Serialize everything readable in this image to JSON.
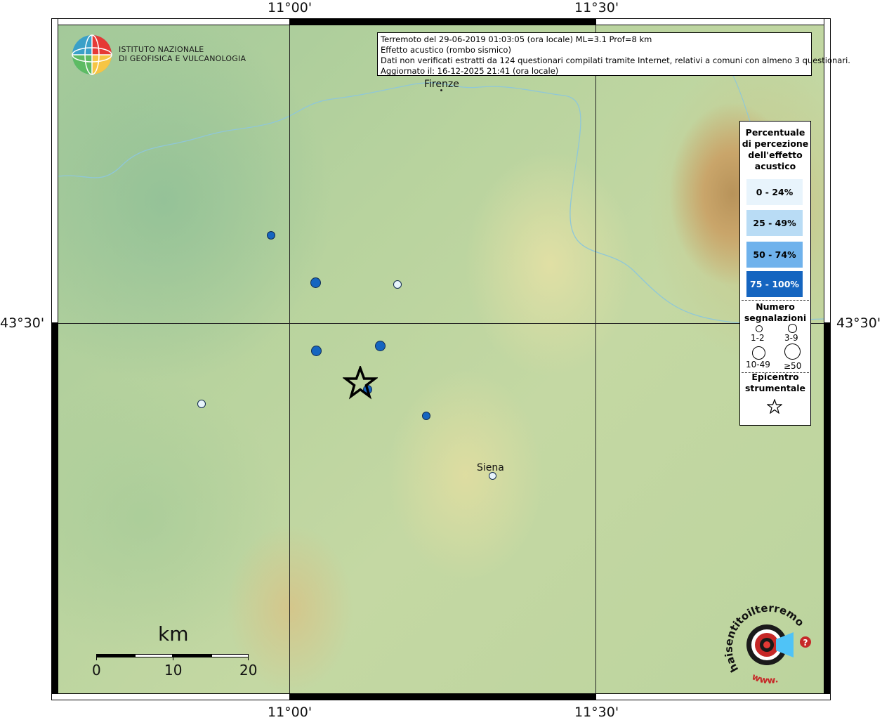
{
  "axes": {
    "lon_labels": [
      "11°00'",
      "11°30'"
    ],
    "lat_labels": [
      "43°30'"
    ]
  },
  "header": {
    "line1": "Terremoto del 29-06-2019 01:03:05 (ora locale) ML=3.1 Prof=8 km",
    "line2": "Effetto acustico (rombo sismico)",
    "line3": "Dati non verificati estratti da 124 questionari compilati tramite Internet, relativi a comuni con almeno 3 questionari.",
    "line4": "Aggiornato il: 16-12-2025 21:41 (ora locale)"
  },
  "logo": {
    "institute_line1": "ISTITUTO NAZIONALE",
    "institute_line2": "DI GEOFISICA E VULCANOLOGIA",
    "hsit_text": "haisentitoilterremoto.it",
    "hsit_www": "www."
  },
  "places": {
    "firenze": "Firenze",
    "siena": "Siena"
  },
  "legend": {
    "title_line1": "Percentuale",
    "title_line2": "di percezione",
    "title_line3": "dell'effetto",
    "title_line4": "acustico",
    "classes": [
      {
        "label": "0 - 24%",
        "color": "#e8f4fc"
      },
      {
        "label": "25 - 49%",
        "color": "#b9dcf5"
      },
      {
        "label": "50 - 74%",
        "color": "#6fb2ec"
      },
      {
        "label": "75 - 100%",
        "color": "#1565c0"
      }
    ],
    "count_title_line1": "Numero",
    "count_title_line2": "segnalazioni",
    "count_classes": [
      "1-2",
      "3-9",
      "10-49",
      "≥50"
    ],
    "epicenter_title_line1": "Epicentro",
    "epicenter_title_line2": "strumentale"
  },
  "scale": {
    "unit": "km",
    "ticks": [
      "0",
      "10",
      "20"
    ]
  },
  "observations": [
    {
      "class": "50-74%+",
      "color": "#1565c0",
      "size": "1-2"
    },
    {
      "class": "75-100%",
      "color": "#1565c0",
      "size": "3-9"
    },
    {
      "class": "0-24%",
      "color": "#e8f4fc",
      "size": "1-2"
    },
    {
      "class": "75-100%",
      "color": "#1565c0",
      "size": "3-9"
    },
    {
      "class": "75-100%",
      "color": "#1565c0",
      "size": "3-9"
    },
    {
      "class": "75-100%",
      "color": "#1565c0",
      "size": "1-2"
    },
    {
      "class": "0-24%",
      "color": "#e8f4fc",
      "size": "1-2"
    },
    {
      "class": "75-100%",
      "color": "#1565c0",
      "size": "1-2"
    },
    {
      "class": "0-24%",
      "color": "#e8f4fc",
      "size": "1-2"
    }
  ],
  "colors": {
    "river": "#8fc7d8",
    "frame": "#000000",
    "epicenter_star": "#000000"
  }
}
